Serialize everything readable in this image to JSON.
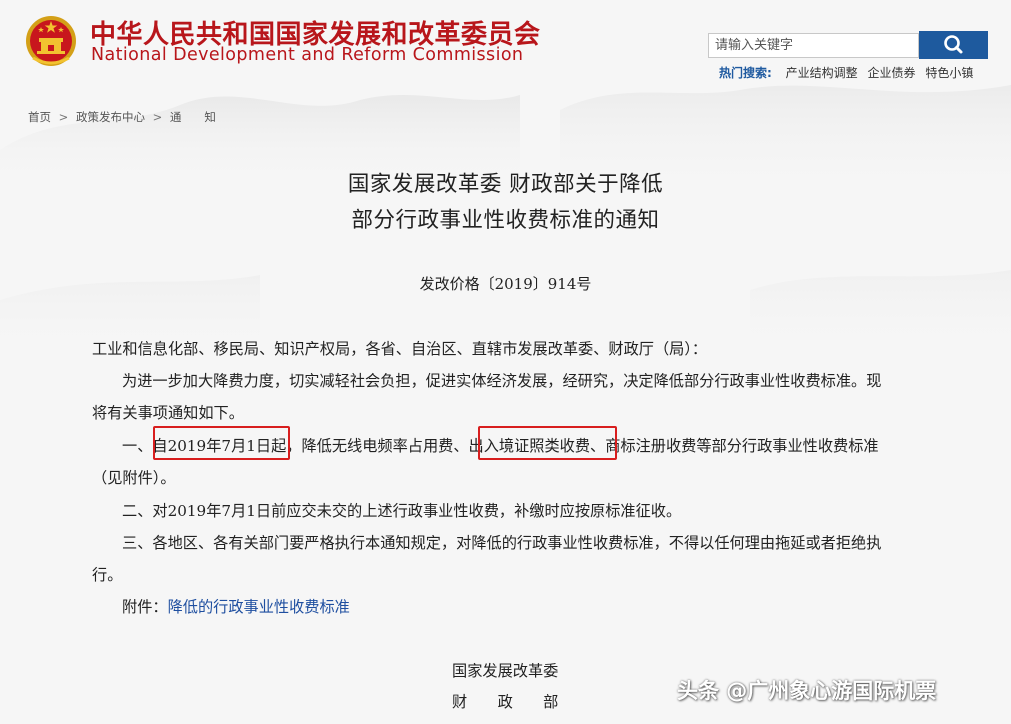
{
  "header": {
    "title_cn": "中华人民共和国国家发展和改革委员会",
    "title_en": "National Development and Reform Commission",
    "emblem_icon": "national-emblem-icon"
  },
  "search": {
    "placeholder": "请输入关键字",
    "button_icon": "search-icon",
    "hot_label": "热门搜索:",
    "hot_items": [
      "产业结构调整",
      "企业债券",
      "特色小镇"
    ]
  },
  "breadcrumb": {
    "items": [
      "首页",
      "政策发布中心",
      "通　　知"
    ],
    "separator": ">"
  },
  "document": {
    "title_line1": "国家发展改革委 财政部关于降低",
    "title_line2": "部分行政事业性收费标准的通知",
    "number": "发改价格〔2019〕914号",
    "addressee": "工业和信息化部、移民局、知识产权局，各省、自治区、直辖市发展改革委、财政厅（局）：",
    "intro_line1": "为进一步加大降费力度，切实减轻社会负担，促进实体经济发展，经研究，决定降低部分行政事业性收费标准。现",
    "intro_line2": "将有关事项通知如下。",
    "item1_prefix": "一、",
    "item1_date": "自2019年7月1日起",
    "item1_mid": "，降低无线电频率占用费、",
    "item1_fee": "出入境证照类收费",
    "item1_rest": "、商标注册收费等部分行政事业性收费标准",
    "item1_line2": "（见附件）。",
    "item2": "二、对2019年7月1日前应交未交的上述行政事业性收费，补缴时应按原标准征收。",
    "item3_line1": "三、各地区、各有关部门要严格执行本通知规定，对降低的行政事业性收费标准，不得以任何理由拖延或者拒绝执",
    "item3_line2": "行。",
    "attachment_label": "附件：",
    "attachment_link": "降低的行政事业性收费标准",
    "signer1": "国家发展改革委",
    "signer2": "财　　政　　部"
  },
  "watermark": "头条 @广州象心游国际机票",
  "colors": {
    "brand_red": "#b8161b",
    "search_blue": "#1e5a9e",
    "link_blue": "#1f4fa0",
    "highlight_red": "#d81e1e"
  }
}
